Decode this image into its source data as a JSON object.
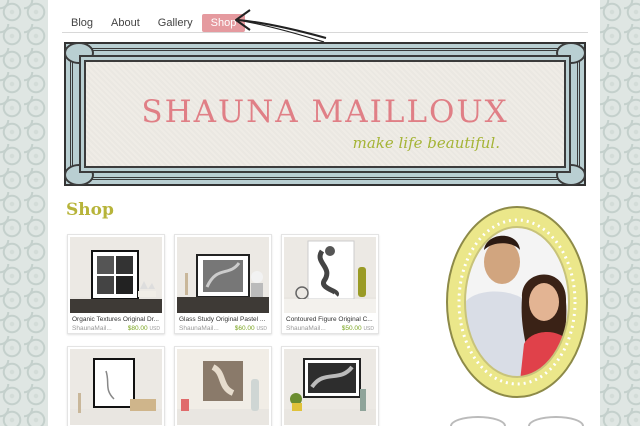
{
  "nav": {
    "items": [
      {
        "label": "Blog"
      },
      {
        "label": "About"
      },
      {
        "label": "Gallery"
      },
      {
        "label": "Shop",
        "active": true
      }
    ]
  },
  "banner": {
    "title": "SHAUNA MAILLOUX",
    "tagline": "make life beautiful."
  },
  "section_title": "Shop",
  "products": [
    {
      "title": "Organic Textures Original Dr...",
      "shop": "ShaunaMail...",
      "price": "$80.00",
      "currency": "USD"
    },
    {
      "title": "Glass Study Original Pastel ...",
      "shop": "ShaunaMail...",
      "price": "$60.00",
      "currency": "USD"
    },
    {
      "title": "Contoured Figure Original C...",
      "shop": "ShaunaMail...",
      "price": "$50.00",
      "currency": "USD"
    },
    {
      "title": "",
      "shop": "",
      "price": "",
      "currency": ""
    },
    {
      "title": "",
      "shop": "",
      "price": "",
      "currency": ""
    },
    {
      "title": "",
      "shop": "",
      "price": "",
      "currency": ""
    }
  ],
  "colors": {
    "accent_pink": "#e59a9f",
    "title_pink": "#e07f86",
    "olive": "#b7b43a",
    "frame_blue": "#b9cfd2",
    "price_green": "#7aa51f",
    "oval_yellow": "#ebe78a"
  }
}
